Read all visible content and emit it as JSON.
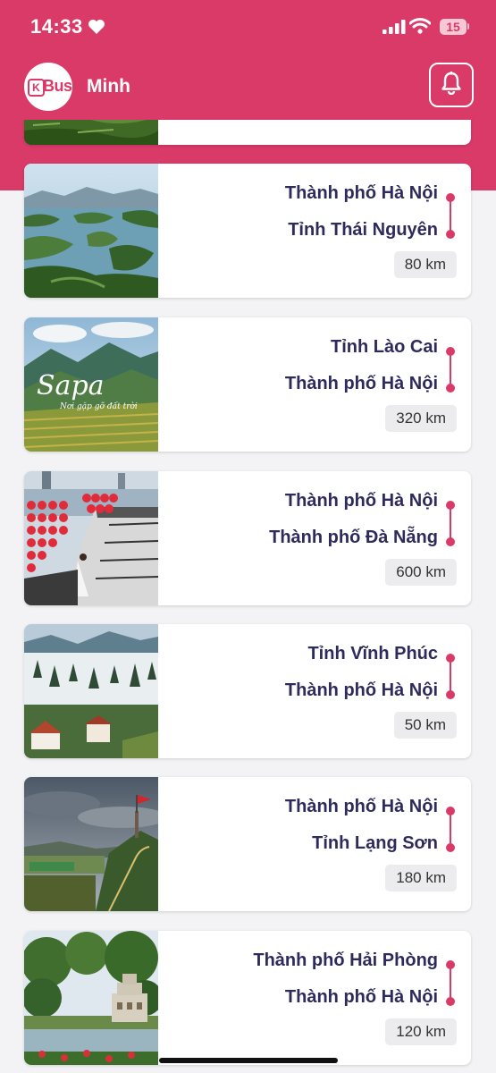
{
  "status_bar": {
    "time": "14:33",
    "battery": "15",
    "heart_icon": "heart-icon",
    "signal_icon": "signal-icon",
    "wifi_icon": "wifi-icon"
  },
  "header": {
    "logo_text": "Bus",
    "logo_mark": "K",
    "user_name": "Minh",
    "bell_icon": "bell-icon"
  },
  "colors": {
    "primary": "#d93a68",
    "route_text": "#2e2a5c",
    "background": "#f3f3f5"
  },
  "routes": [
    {
      "from": "Thành phố Hà Nội",
      "to": "Tỉnh Thái Nguyên",
      "distance": "80 km",
      "image": "lake-islands"
    },
    {
      "from": "Tỉnh Lào Cai",
      "to": "Thành phố Hà Nội",
      "distance": "320 km",
      "image": "sapa-valley",
      "image_text": "Sapa",
      "image_subtext": "Nơi gặp gỡ đất trời"
    },
    {
      "from": "Thành phố Hà Nội",
      "to": "Thành phố Đà Nẵng",
      "distance": "600 km",
      "image": "danang-lantern-bridge"
    },
    {
      "from": "Tỉnh Vĩnh Phúc",
      "to": "Thành phố Hà Nội",
      "distance": "50 km",
      "image": "misty-mountain-town"
    },
    {
      "from": "Thành phố Hà Nội",
      "to": "Tỉnh Lạng Sơn",
      "distance": "180 km",
      "image": "flag-tower-hill"
    },
    {
      "from": "Thành phố Hải Phòng",
      "to": "Thành phố Hà Nội",
      "distance": "120 km",
      "image": "turtle-tower-lake"
    }
  ]
}
